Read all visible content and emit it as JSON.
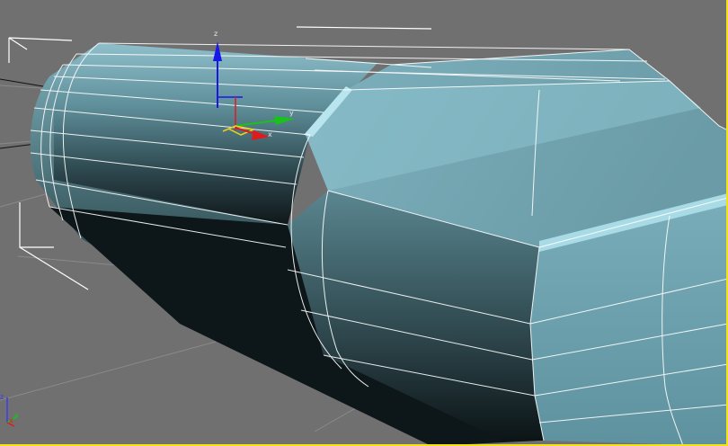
{
  "viewport": {
    "colors": {
      "background": "#707070",
      "active_border": "#f2e21a",
      "grid_line": "#8a8a8a",
      "bounding_box": "#ffffff",
      "mesh_light": "#8fc4d2",
      "mesh_mid": "#6aa2b0",
      "mesh_dark": "#1b2a2e",
      "wire": "#ffffff"
    }
  },
  "transform_gizmo": {
    "axis_labels": {
      "x": "x",
      "y": "y",
      "z": "z"
    },
    "colors": {
      "x": "#e01b1b",
      "y": "#19c21b",
      "z": "#1818e6",
      "plane": "#e8d21a"
    }
  },
  "view_axis_tripod": {
    "axis_labels": {
      "x": "x",
      "y": "y",
      "z": "z"
    },
    "colors": {
      "x": "#e01b1b",
      "y": "#19c21b",
      "z": "#3a3af0"
    }
  }
}
